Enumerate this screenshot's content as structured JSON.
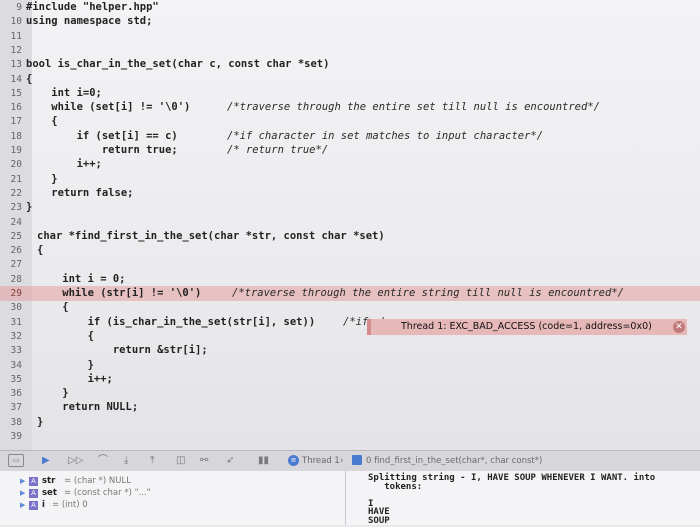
{
  "code_lines": [
    {
      "num": "9",
      "code": "#include \"helper.hpp\"",
      "comment": ""
    },
    {
      "num": "10",
      "code": "using namespace std;",
      "comment": ""
    },
    {
      "num": "11",
      "code": "",
      "comment": ""
    },
    {
      "num": "12",
      "code": "",
      "comment": ""
    },
    {
      "num": "13",
      "code": "bool is_char_in_the_set(char c, const char *set)",
      "comment": ""
    },
    {
      "num": "14",
      "code": "{",
      "comment": ""
    },
    {
      "num": "15",
      "code": "    int i=0;",
      "comment": ""
    },
    {
      "num": "16",
      "code": "    while (set[i] != '\\0')",
      "comment": "/*traverse through the entire set till null is encountred*/"
    },
    {
      "num": "17",
      "code": "    {",
      "comment": ""
    },
    {
      "num": "18",
      "code": "        if (set[i] == c)",
      "comment": "/*if character in set matches to input character*/"
    },
    {
      "num": "19",
      "code": "            return true;",
      "comment": "/* return true*/"
    },
    {
      "num": "20",
      "code": "        i++;",
      "comment": ""
    },
    {
      "num": "21",
      "code": "    }",
      "comment": ""
    },
    {
      "num": "22",
      "code": "    return false;",
      "comment": ""
    },
    {
      "num": "23",
      "code": "}",
      "comment": ""
    },
    {
      "num": "24",
      "code": "",
      "comment": ""
    },
    {
      "num": "25",
      "code": "char *find_first_in_the_set(char *str, const char *set)",
      "comment": ""
    },
    {
      "num": "26",
      "code": "{",
      "comment": ""
    },
    {
      "num": "27",
      "code": "",
      "comment": ""
    },
    {
      "num": "28",
      "code": "    int i = 0;",
      "comment": ""
    },
    {
      "num": "29",
      "code": "    while (str[i] != '\\0')",
      "comment": "/*traverse through the entire string till null is encountred*/"
    },
    {
      "num": "30",
      "code": "    {",
      "comment": ""
    },
    {
      "num": "31",
      "code": "        if (is_char_in_the_set(str[i], set))",
      "comment": "/*if ch"
    },
    {
      "num": "32",
      "code": "        {",
      "comment": ""
    },
    {
      "num": "33",
      "code": "            return &str[i];",
      "comment": ""
    },
    {
      "num": "34",
      "code": "        }",
      "comment": ""
    },
    {
      "num": "35",
      "code": "        i++;",
      "comment": ""
    },
    {
      "num": "36",
      "code": "    }",
      "comment": ""
    },
    {
      "num": "37",
      "code": "    return NULL;",
      "comment": ""
    },
    {
      "num": "38",
      "code": "}",
      "comment": ""
    },
    {
      "num": "39",
      "code": "",
      "comment": ""
    }
  ],
  "error_banner": {
    "text": "Thread 1: EXC_BAD_ACCESS (code=1, address=0x0)",
    "line": "29"
  },
  "debug_bar": {
    "thread_label": "Thread 1",
    "frame_label": "0 find_first_in_the_set(char*, char const*)",
    "icons": [
      "breakpoints-toggle-icon",
      "continue-icon",
      "step-over-icon",
      "step-into-icon",
      "step-out-icon",
      "view-hierarchy-icon",
      "memory-graph-icon",
      "location-icon",
      "frames-icon"
    ]
  },
  "variables": [
    {
      "name": "str",
      "value": "= (char *) NULL"
    },
    {
      "name": "set",
      "value": "= (const char *) \"...\""
    },
    {
      "name": "i",
      "value": "= (int) 0"
    }
  ],
  "console": [
    "Splitting string - I, HAVE SOUP WHENEVER I WANT. into",
    "   tokens:",
    "",
    "I",
    "HAVE",
    "SOUP"
  ],
  "colors": {
    "error_highlight": "#e4a0a0",
    "banner_bg": "#e7b8b8",
    "variable_badge": "#7b72c9",
    "thread_icon": "#4a7bd0"
  }
}
